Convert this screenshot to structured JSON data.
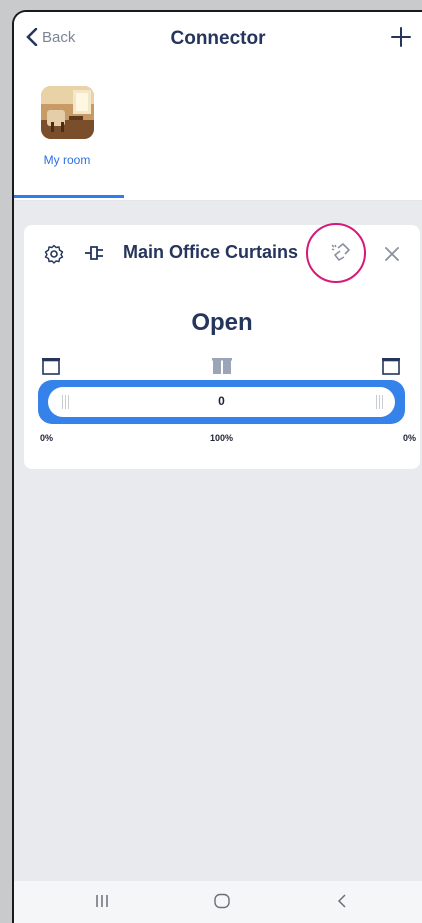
{
  "header": {
    "back_label": "Back",
    "title": "Connector"
  },
  "rooms": [
    {
      "label": "My room",
      "selected": true
    }
  ],
  "device_card": {
    "name": "Main Office Curtains",
    "state": "Open",
    "slider": {
      "value": "0",
      "left_tick": "0%",
      "mid_tick": "100%",
      "right_tick": "0%"
    }
  },
  "colors": {
    "accent": "#2e7df0",
    "title": "#25355c",
    "highlight": "#d4197a"
  },
  "icons": [
    "chevron-left-icon",
    "plus-icon",
    "gear-icon",
    "plug-icon",
    "unlink-icon",
    "close-icon",
    "curtain-open-left-icon",
    "curtain-closed-icon",
    "curtain-open-right-icon",
    "recent-apps-icon",
    "home-icon",
    "nav-back-icon"
  ]
}
